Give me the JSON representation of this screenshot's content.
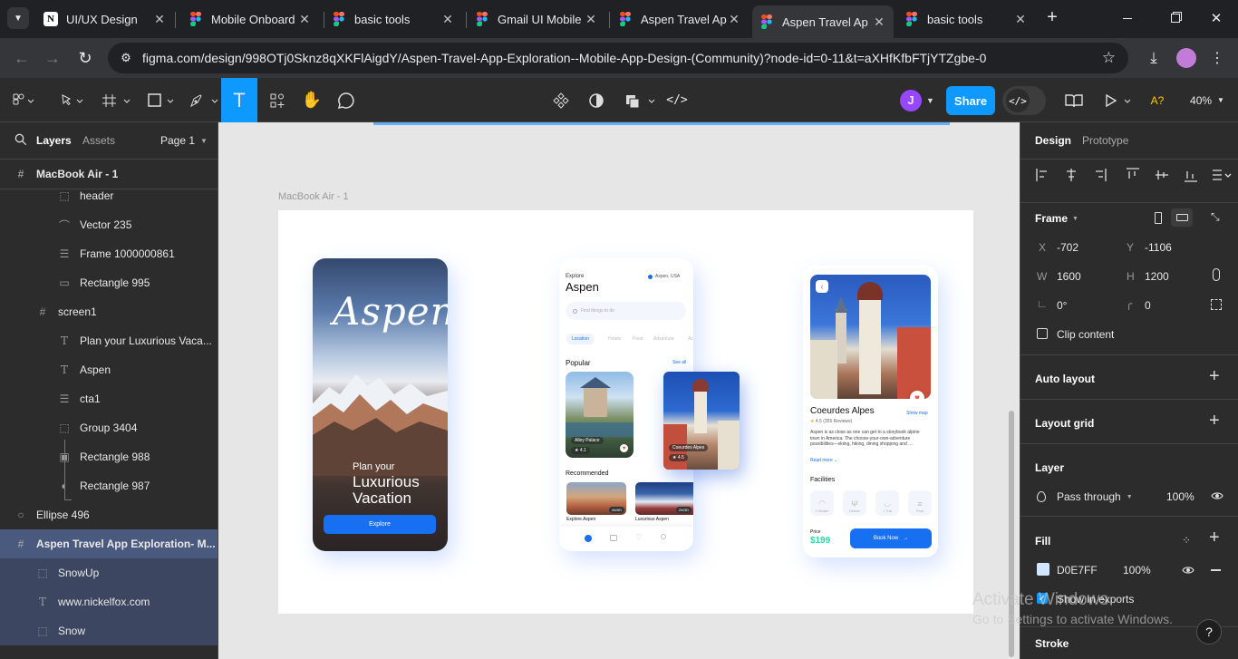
{
  "browser": {
    "tabs": [
      {
        "title": "UI/UX Design",
        "favicon": "notion-icon"
      },
      {
        "title": "Mobile Onboard",
        "favicon": "figma-icon"
      },
      {
        "title": "basic tools",
        "favicon": "figma-icon"
      },
      {
        "title": "Gmail UI Mobile",
        "favicon": "figma-icon"
      },
      {
        "title": "Aspen Travel Ap",
        "favicon": "figma-icon"
      },
      {
        "title": "Aspen Travel Ap",
        "favicon": "figma-icon",
        "active": true
      },
      {
        "title": "basic tools",
        "favicon": "figma-icon"
      }
    ],
    "url": "figma.com/design/998OTj0Sknz8qXKFlAigdY/Aspen-Travel-App-Exploration--Mobile-App-Design-(Community)?node-id=0-11&t=aXHfKfbFTjYTZgbe-0"
  },
  "toolbar": {
    "avatar_letter": "J",
    "share_label": "Share",
    "zoom": "40%",
    "a_label": "A?"
  },
  "left_panel": {
    "tabs": {
      "layers": "Layers",
      "assets": "Assets"
    },
    "page": "Page 1",
    "frame_root": "MacBook Air - 1",
    "layers": [
      {
        "name": "header",
        "icon": "frame-dashed-icon"
      },
      {
        "name": "Vector 235",
        "icon": "vector-icon"
      },
      {
        "name": "Frame 1000000861",
        "icon": "autolayout-icon"
      },
      {
        "name": "Rectangle 995",
        "icon": "rectangle-icon"
      },
      {
        "name": "screen1",
        "icon": "frame-icon"
      },
      {
        "name": "Plan your Luxurious Vaca...",
        "icon": "text-icon"
      },
      {
        "name": "Aspen",
        "icon": "text-icon"
      },
      {
        "name": "cta1",
        "icon": "autolayout-icon"
      },
      {
        "name": "Group 3404",
        "icon": "group-icon"
      },
      {
        "name": "Rectangle 988",
        "icon": "image-icon"
      },
      {
        "name": "Rectangle 987",
        "icon": "ellipse-half-icon"
      },
      {
        "name": "Ellipse 496",
        "icon": "ellipse-icon"
      },
      {
        "name": "Aspen Travel App Exploration- M...",
        "icon": "frame-icon"
      },
      {
        "name": "SnowUp",
        "icon": "group-icon"
      },
      {
        "name": "www.nickelfox.com",
        "icon": "text-icon"
      },
      {
        "name": "Snow",
        "icon": "group-icon"
      }
    ]
  },
  "canvas": {
    "frame_label": "MacBook Air - 1",
    "screen1": {
      "logo": "Aspen",
      "line1": "Plan your",
      "line2": "Luxurious",
      "line3": "Vacation",
      "cta": "Explore"
    },
    "screen2": {
      "explore": "Explore",
      "title": "Aspen",
      "location": "Aspen, USA",
      "search_placeholder": "Find things to do",
      "chips": [
        "Location",
        "Hotels",
        "Food",
        "Adventure",
        "Ac"
      ],
      "popular": "Popular",
      "see_all": "See all",
      "card1": "Alley Palace",
      "card1_rating": "4.1",
      "recommended": "Recommended",
      "rec1": "Explore Aspen",
      "rec1_badge": "4N/5D",
      "rec2": "Luxurious Aspen",
      "rec2_badge": "2N/3D"
    },
    "floating_card": {
      "name": "Coeurdes Alpes",
      "rating": "4.5"
    },
    "screen3": {
      "title": "Coeurdes Alpes",
      "show_map": "Show map",
      "rating": "4.5 (355 Reviews)",
      "desc": "Aspen is as close as one can get to a storybook alpine town in America. The choose-your-own-adventure possibilities—skiing, hiking, dining shopping and ....",
      "read_more": "Read more",
      "facilities": "Facilities",
      "facility_items": [
        "1 Heater",
        "Dinner",
        "1 Tub",
        "Pool"
      ],
      "price_label": "Price",
      "price": "$199",
      "book": "Book Now"
    }
  },
  "right_panel": {
    "tabs": {
      "design": "Design",
      "prototype": "Prototype"
    },
    "frame_label": "Frame",
    "x_label": "X",
    "x": "-702",
    "y_label": "Y",
    "y": "-1106",
    "w_label": "W",
    "w": "1600",
    "h_label": "H",
    "h": "1200",
    "rotation": "0°",
    "radius": "0",
    "clip_content": "Clip content",
    "auto_layout": "Auto layout",
    "layout_grid": "Layout grid",
    "layer": "Layer",
    "blend": "Pass through",
    "opacity": "100%",
    "fill": "Fill",
    "fill_hex": "D0E7FF",
    "fill_opacity": "100%",
    "show_in_exports": "Show in exports",
    "stroke": "Stroke"
  },
  "watermark": {
    "line1": "Activate Windows",
    "line2": "Go to Settings to activate Windows."
  },
  "colors": {
    "accent": "#0d99ff",
    "app_blue": "#176ff2",
    "price_green": "#2dd7a4",
    "fill_swatch": "#d0e7ff"
  }
}
